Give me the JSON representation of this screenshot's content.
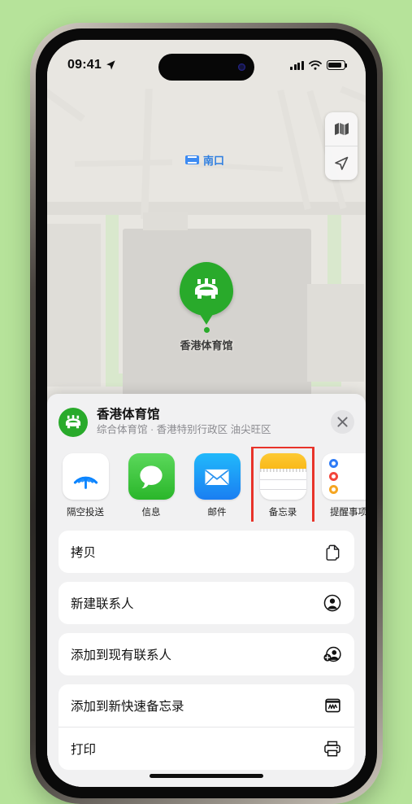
{
  "statusbar": {
    "time": "09:41",
    "location_arrow_icon": "location-arrow-icon",
    "cellular_icon": "cellular-bars-icon",
    "wifi_icon": "wifi-icon",
    "battery_icon": "battery-icon"
  },
  "map": {
    "transit_label": "南口",
    "transit_badge_icon": "subway-badge-icon",
    "pin_label": "香港体育馆",
    "pin_icon": "stadium-icon",
    "controls": [
      {
        "name": "map-mode-button",
        "icon": "map-layers-icon"
      },
      {
        "name": "locate-me-button",
        "icon": "location-arrow-icon"
      }
    ],
    "pin_color": "#29aa2b"
  },
  "sheet": {
    "place": {
      "icon": "stadium-icon",
      "title": "香港体育馆",
      "subtitle": "综合体育馆 · 香港特别行政区 油尖旺区"
    },
    "close_label": "✕",
    "apps": [
      {
        "label": "隔空投送",
        "icon": "airdrop-icon",
        "highlighted": false
      },
      {
        "label": "信息",
        "icon": "messages-icon",
        "highlighted": false
      },
      {
        "label": "邮件",
        "icon": "mail-icon",
        "highlighted": false
      },
      {
        "label": "备忘录",
        "icon": "notes-icon",
        "highlighted": true
      },
      {
        "label": "提醒事项",
        "icon": "reminders-icon",
        "highlighted": false
      }
    ],
    "highlight_color": "#e8332a",
    "groups": [
      {
        "rows": [
          {
            "label": "拷贝",
            "icon": "copy-icon"
          }
        ]
      },
      {
        "rows": [
          {
            "label": "新建联系人",
            "icon": "person-circle-icon"
          }
        ]
      },
      {
        "rows": [
          {
            "label": "添加到现有联系人",
            "icon": "person-add-icon"
          }
        ]
      },
      {
        "rows": [
          {
            "label": "添加到新快速备忘录",
            "icon": "quick-note-icon"
          },
          {
            "label": "打印",
            "icon": "printer-icon"
          }
        ]
      }
    ]
  }
}
